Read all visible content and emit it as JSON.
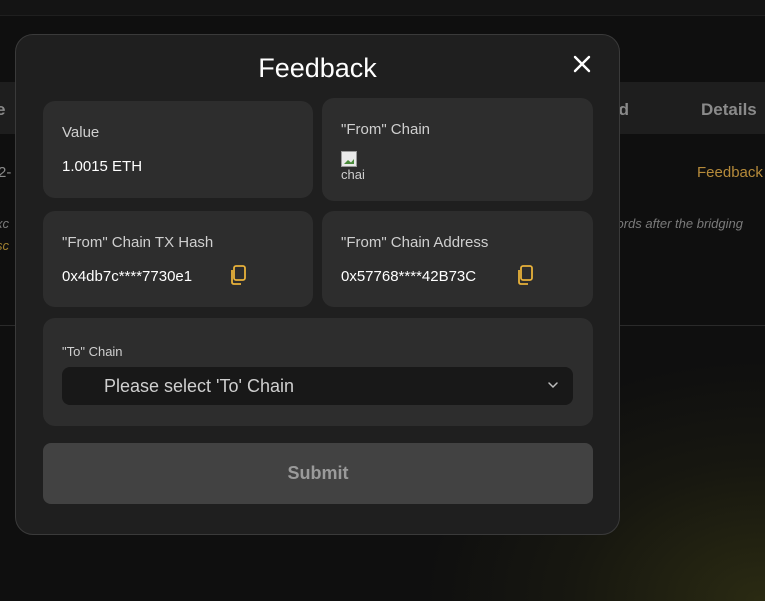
{
  "background": {
    "col_left": "e",
    "col_record": "rd",
    "col_details": "Details",
    "row_cut": "2-",
    "row_feedback": "Feedback",
    "note_left": "xc",
    "note_right": "cords after the bridging",
    "note_left2": "sc"
  },
  "modal": {
    "title": "Feedback",
    "close_icon": "close-icon",
    "value_label": "Value",
    "value": "1.0015 ETH",
    "from_chain_label": "\"From\" Chain",
    "from_chain_img_alt": "chai",
    "tx_hash_label": "\"From\" Chain TX Hash",
    "tx_hash": "0x4db7c****7730e1",
    "address_label": "\"From\" Chain Address",
    "address": "0x57768****42B73C",
    "to_chain_label": "\"To\" Chain",
    "to_chain_placeholder": "Please select 'To' Chain",
    "submit_label": "Submit"
  },
  "colors": {
    "accent": "#e8b13a",
    "modal_bg": "#1f1f1f",
    "card_bg": "#2d2d2d",
    "submit_bg": "#424242"
  }
}
